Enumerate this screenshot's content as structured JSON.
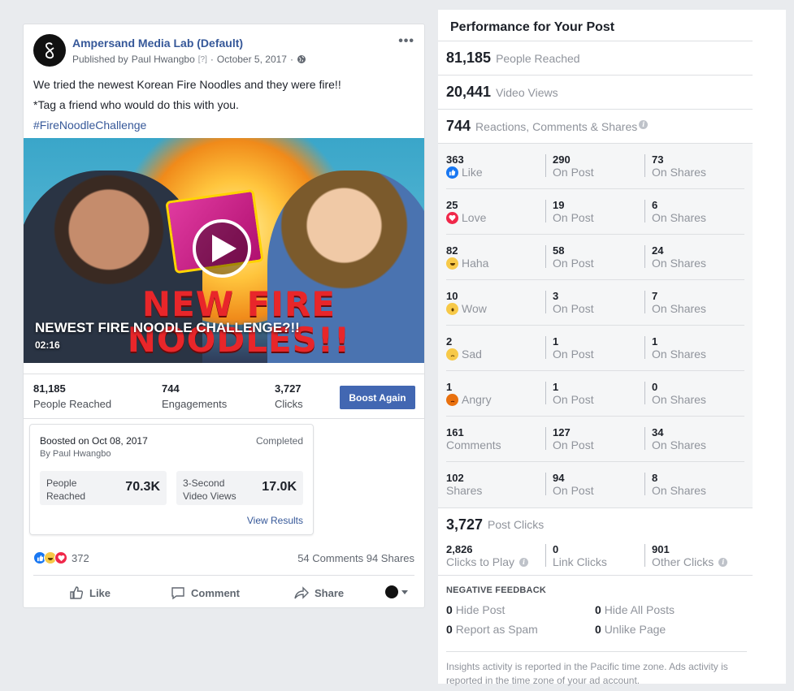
{
  "post": {
    "page_name": "Ampersand Media Lab (Default)",
    "published_by_label": "Published by",
    "author": "Paul Hwangbo",
    "help_marker": "[?]",
    "date": "October 5, 2017",
    "text_line1": "We tried the newest Korean Fire Noodles and they were fire!!",
    "text_line2": "*Tag a friend who would do this with you.",
    "hashtag": "#FireNoodleChallenge",
    "video": {
      "big_title_line1": "NEW FIRE",
      "big_title_line2": "NOODLES!!",
      "caption": "NEWEST FIRE NOODLE CHALLENGE?!!",
      "duration": "02:16"
    },
    "stats": [
      {
        "value": "81,185",
        "label": "People Reached"
      },
      {
        "value": "744",
        "label": "Engagements"
      },
      {
        "value": "3,727",
        "label": "Clicks"
      }
    ],
    "boost_button": "Boost Again",
    "boost_card": {
      "title": "Boosted on Oct 08, 2017",
      "by": "By Paul Hwangbo",
      "status": "Completed",
      "metric1_label_line1": "People",
      "metric1_label_line2": "Reached",
      "metric1_value": "70.3K",
      "metric2_label_line1": "3-Second",
      "metric2_label_line2": "Video Views",
      "metric2_value": "17.0K",
      "view_results": "View Results"
    },
    "reactions_count": "372",
    "comments_shares": "54 Comments  94 Shares",
    "actions": {
      "like": "Like",
      "comment": "Comment",
      "share": "Share"
    }
  },
  "panel": {
    "title": "Performance for Your Post",
    "reached": {
      "value": "81,185",
      "label": "People Reached"
    },
    "views": {
      "value": "20,441",
      "label": "Video Views"
    },
    "engagement": {
      "value": "744",
      "label": "Reactions, Comments & Shares"
    },
    "rows": [
      {
        "total": "363",
        "name": "Like",
        "on_post": "290",
        "on_shares": "73"
      },
      {
        "total": "25",
        "name": "Love",
        "on_post": "19",
        "on_shares": "6"
      },
      {
        "total": "82",
        "name": "Haha",
        "on_post": "58",
        "on_shares": "24"
      },
      {
        "total": "10",
        "name": "Wow",
        "on_post": "3",
        "on_shares": "7"
      },
      {
        "total": "2",
        "name": "Sad",
        "on_post": "1",
        "on_shares": "1"
      },
      {
        "total": "1",
        "name": "Angry",
        "on_post": "1",
        "on_shares": "0"
      },
      {
        "total": "161",
        "name": "Comments",
        "on_post": "127",
        "on_shares": "34"
      },
      {
        "total": "102",
        "name": "Shares",
        "on_post": "94",
        "on_shares": "8"
      }
    ],
    "on_post_label": "On Post",
    "on_shares_label": "On Shares",
    "post_clicks": {
      "value": "3,727",
      "label": "Post Clicks"
    },
    "clicks": [
      {
        "value": "2,826",
        "label": "Clicks to Play"
      },
      {
        "value": "0",
        "label": "Link Clicks"
      },
      {
        "value": "901",
        "label": "Other Clicks"
      }
    ],
    "negative": {
      "title": "NEGATIVE FEEDBACK",
      "hide_post": {
        "value": "0",
        "label": "Hide Post"
      },
      "hide_all": {
        "value": "0",
        "label": "Hide All Posts"
      },
      "spam": {
        "value": "0",
        "label": "Report as Spam"
      },
      "unlike": {
        "value": "0",
        "label": "Unlike Page"
      }
    },
    "footnote": "Insights activity is reported in the Pacific time zone. Ads activity is reported in the time zone of your ad account."
  },
  "colors": {
    "brand": "#4267b2",
    "link": "#365899",
    "muted": "#90949c"
  }
}
